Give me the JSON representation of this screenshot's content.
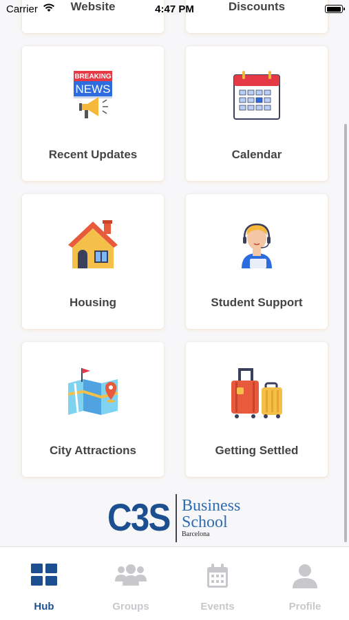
{
  "status_bar": {
    "carrier": "Carrier",
    "time": "4:47 PM"
  },
  "partial_cards": {
    "left": "Website",
    "right": "Discounts"
  },
  "cards": [
    {
      "label": "Recent Updates",
      "icon": "breaking-news-icon",
      "breaking_top": "BREAKING",
      "breaking_bottom": "NEWS"
    },
    {
      "label": "Calendar",
      "icon": "calendar-icon"
    },
    {
      "label": "Housing",
      "icon": "house-icon"
    },
    {
      "label": "Student Support",
      "icon": "support-agent-icon"
    },
    {
      "label": "City Attractions",
      "icon": "map-icon"
    },
    {
      "label": "Getting Settled",
      "icon": "luggage-icon"
    }
  ],
  "logo": {
    "mark": "C3S",
    "line1": "Business",
    "line2": "School",
    "city": "Barcelona"
  },
  "tabs": [
    {
      "label": "Hub",
      "icon": "grid-icon",
      "active": true
    },
    {
      "label": "Groups",
      "icon": "people-icon",
      "active": false
    },
    {
      "label": "Events",
      "icon": "calendar-icon",
      "active": false
    },
    {
      "label": "Profile",
      "icon": "person-icon",
      "active": false
    }
  ],
  "colors": {
    "accent": "#1c4f8f",
    "inactive": "#c8c8cc",
    "background": "#f7f7f9"
  }
}
